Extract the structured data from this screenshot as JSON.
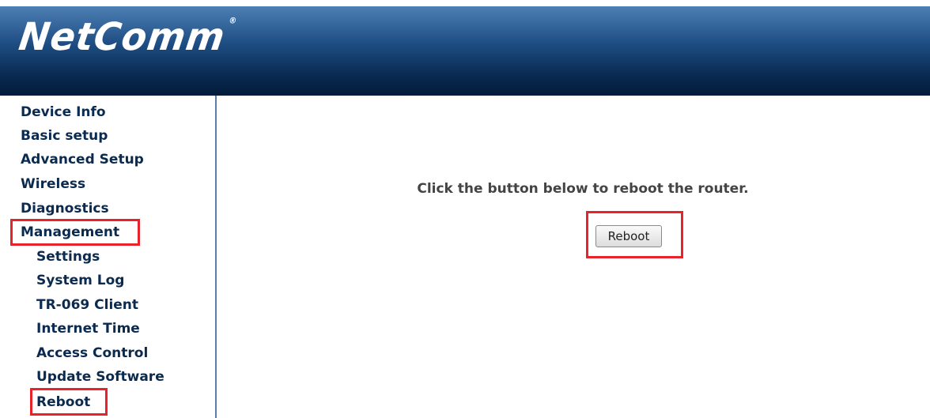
{
  "brand": {
    "logo_text": "NetComm",
    "trademark": "®"
  },
  "sidebar": {
    "items": [
      {
        "label": "Device Info"
      },
      {
        "label": "Basic setup"
      },
      {
        "label": "Advanced Setup"
      },
      {
        "label": "Wireless"
      },
      {
        "label": "Diagnostics"
      },
      {
        "label": "Management"
      }
    ],
    "management_subitems": [
      {
        "label": "Settings"
      },
      {
        "label": "System Log"
      },
      {
        "label": "TR-069 Client"
      },
      {
        "label": "Internet Time"
      },
      {
        "label": "Access Control"
      },
      {
        "label": "Update Software"
      },
      {
        "label": "Reboot"
      }
    ]
  },
  "main": {
    "instruction": "Click the button below to reboot the router.",
    "reboot_button_label": "Reboot"
  },
  "colors": {
    "header_dark": "#021a38",
    "header_light": "#4d7fb5",
    "nav_text": "#0b2a4f",
    "highlight": "#e8232a"
  }
}
